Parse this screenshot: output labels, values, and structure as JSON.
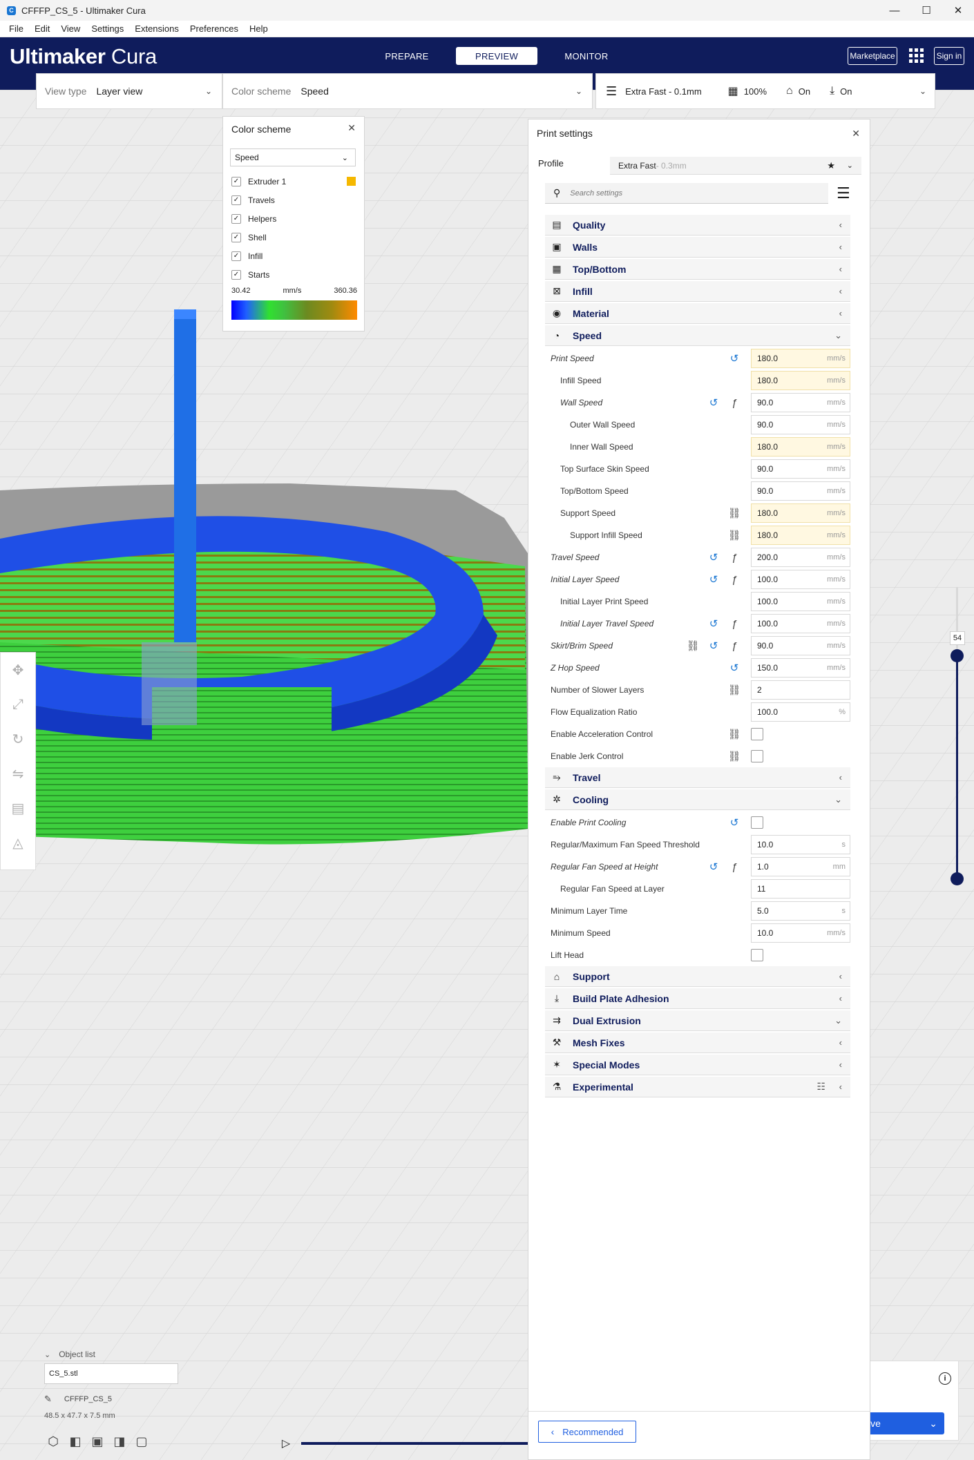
{
  "window": {
    "title": "CFFFP_CS_5 - Ultimaker Cura",
    "minimize": "—",
    "maximize": "☐",
    "close": "✕"
  },
  "menu": [
    "File",
    "Edit",
    "View",
    "Settings",
    "Extensions",
    "Preferences",
    "Help"
  ],
  "header": {
    "logo_bold": "Ultimaker",
    "logo_light": "Cura",
    "tabs": [
      "PREPARE",
      "PREVIEW",
      "MONITOR"
    ],
    "active_tab": "PREVIEW",
    "marketplace": "Marketplace",
    "sign_in": "Sign in"
  },
  "viewbar": {
    "view_type_label": "View type",
    "view_type_value": "Layer view",
    "color_scheme_label": "Color scheme",
    "color_scheme_value": "Speed"
  },
  "printbar": {
    "profile": "Extra Fast - 0.1mm",
    "infill": "100%",
    "support": "On",
    "adhesion": "On"
  },
  "color_scheme_panel": {
    "title": "Color scheme",
    "select_value": "Speed",
    "items": [
      "Extruder 1",
      "Travels",
      "Helpers",
      "Shell",
      "Infill",
      "Starts"
    ],
    "extruder_color": "#f5b800",
    "min": "30.42",
    "unit": "mm/s",
    "max": "360.36"
  },
  "print_settings": {
    "title": "Print settings",
    "profile_label": "Profile",
    "profile_name": "Extra Fast",
    "profile_suffix": " - 0.3mm",
    "search_placeholder": "Search settings",
    "categories_top": [
      "Quality",
      "Walls",
      "Top/Bottom",
      "Infill",
      "Material",
      "Speed"
    ],
    "speed_settings": [
      {
        "name": "Print Speed",
        "value": "180.0",
        "unit": "mm/s"
      },
      {
        "name": "Infill Speed",
        "value": "180.0",
        "unit": "mm/s"
      },
      {
        "name": "Wall Speed",
        "value": "90.0",
        "unit": "mm/s"
      },
      {
        "name": "Outer Wall Speed",
        "value": "90.0",
        "unit": "mm/s"
      },
      {
        "name": "Inner Wall Speed",
        "value": "180.0",
        "unit": "mm/s"
      },
      {
        "name": "Top Surface Skin Speed",
        "value": "90.0",
        "unit": "mm/s"
      },
      {
        "name": "Top/Bottom Speed",
        "value": "90.0",
        "unit": "mm/s"
      },
      {
        "name": "Support Speed",
        "value": "180.0",
        "unit": "mm/s"
      },
      {
        "name": "Support Infill Speed",
        "value": "180.0",
        "unit": "mm/s"
      },
      {
        "name": "Travel Speed",
        "value": "200.0",
        "unit": "mm/s"
      },
      {
        "name": "Initial Layer Speed",
        "value": "100.0",
        "unit": "mm/s"
      },
      {
        "name": "Initial Layer Print Speed",
        "value": "100.0",
        "unit": "mm/s"
      },
      {
        "name": "Initial Layer Travel Speed",
        "value": "100.0",
        "unit": "mm/s"
      },
      {
        "name": "Skirt/Brim Speed",
        "value": "90.0",
        "unit": "mm/s"
      },
      {
        "name": "Z Hop Speed",
        "value": "150.0",
        "unit": "mm/s"
      },
      {
        "name": "Number of Slower Layers",
        "value": "2",
        "unit": ""
      },
      {
        "name": "Flow Equalization Ratio",
        "value": "100.0",
        "unit": "%"
      },
      {
        "name": "Enable Acceleration Control",
        "value": "",
        "unit": ""
      },
      {
        "name": "Enable Jerk Control",
        "value": "",
        "unit": ""
      }
    ],
    "travel": "Travel",
    "cooling": "Cooling",
    "cooling_settings": [
      {
        "name": "Enable Print Cooling",
        "value": "",
        "unit": ""
      },
      {
        "name": "Regular/Maximum Fan Speed Threshold",
        "value": "10.0",
        "unit": "s"
      },
      {
        "name": "Regular Fan Speed at Height",
        "value": "1.0",
        "unit": "mm"
      },
      {
        "name": "Regular Fan Speed at Layer",
        "value": "11",
        "unit": ""
      },
      {
        "name": "Minimum Layer Time",
        "value": "5.0",
        "unit": "s"
      },
      {
        "name": "Minimum Speed",
        "value": "10.0",
        "unit": "mm/s"
      },
      {
        "name": "Lift Head",
        "value": "",
        "unit": ""
      }
    ],
    "categories_bottom": [
      "Support",
      "Build Plate Adhesion",
      "Dual Extrusion",
      "Mesh Fixes",
      "Special Modes",
      "Experimental"
    ],
    "recommended": "Recommended"
  },
  "layer_slider": {
    "value": "54"
  },
  "object_list": {
    "label": "Object list",
    "file": "CS_5.stl",
    "job_name": "CFFFP_CS_5",
    "dimensions": "48.5 x 47.7 x 7.5 mm"
  },
  "save": {
    "label": "ive"
  }
}
